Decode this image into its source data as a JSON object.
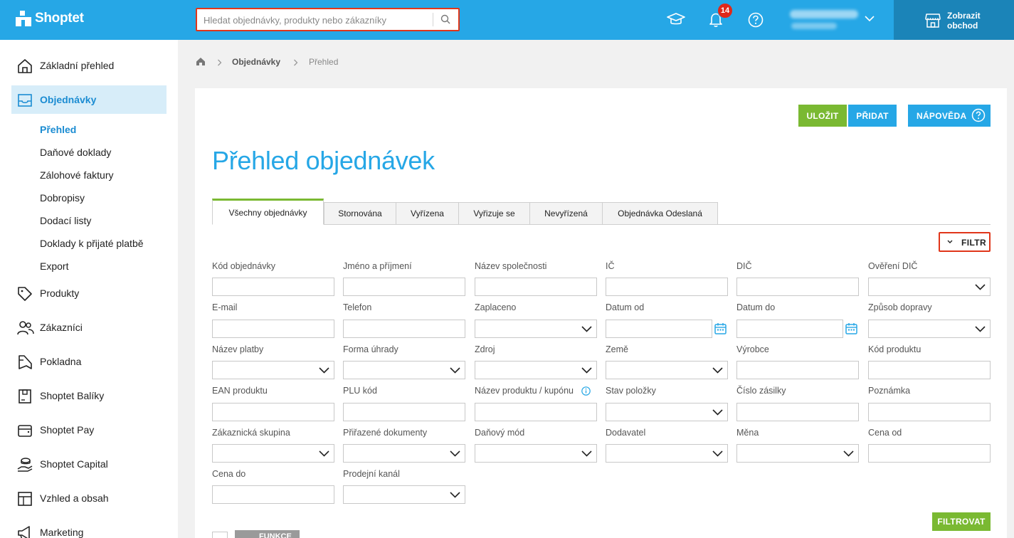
{
  "header": {
    "logo_text": "Shoptet",
    "search_placeholder": "Hledat objednávky, produkty nebo zákazníky",
    "notification_count": "14",
    "store_button": "Zobrazit obchod",
    "colors": {
      "bar": "#26a7e6",
      "store_button": "#1b84b8",
      "badge": "#e0281a"
    }
  },
  "sidebar": {
    "items": [
      {
        "label": "Základní přehled",
        "icon": "home-icon"
      },
      {
        "label": "Objednávky",
        "icon": "inbox-icon",
        "active": true
      },
      {
        "label": "Produkty",
        "icon": "tag-icon"
      },
      {
        "label": "Zákazníci",
        "icon": "users-icon"
      },
      {
        "label": "Pokladna",
        "icon": "receipt-icon"
      },
      {
        "label": "Shoptet Balíky",
        "icon": "package-icon"
      },
      {
        "label": "Shoptet Pay",
        "icon": "wallet-icon"
      },
      {
        "label": "Shoptet Capital",
        "icon": "money-hand-icon"
      },
      {
        "label": "Vzhled a obsah",
        "icon": "layout-icon"
      },
      {
        "label": "Marketing",
        "icon": "megaphone-icon"
      }
    ],
    "subitems": [
      {
        "label": "Přehled",
        "active": true
      },
      {
        "label": "Daňové doklady"
      },
      {
        "label": "Zálohové faktury"
      },
      {
        "label": "Dobropisy"
      },
      {
        "label": "Dodací listy"
      },
      {
        "label": "Doklady k přijaté platbě"
      },
      {
        "label": "Export"
      }
    ]
  },
  "breadcrumb": {
    "section": "Objednávky",
    "current": "Přehled"
  },
  "toolbar": {
    "save": "ULOŽIT",
    "add": "PŘIDAT",
    "help": "NÁPOVĚDA"
  },
  "page_title": "Přehled objednávek",
  "tabs": [
    {
      "label": "Všechny objednávky",
      "active": true
    },
    {
      "label": "Stornována"
    },
    {
      "label": "Vyřízena"
    },
    {
      "label": "Vyřizuje se"
    },
    {
      "label": "Nevyřízená"
    },
    {
      "label": "Objednávka Odeslaná"
    }
  ],
  "filter_button": "FILTR",
  "filters": [
    {
      "label": "Kód objednávky",
      "type": "text"
    },
    {
      "label": "Jméno a příjmení",
      "type": "text"
    },
    {
      "label": "Název společnosti",
      "type": "text"
    },
    {
      "label": "IČ",
      "type": "text"
    },
    {
      "label": "DIČ",
      "type": "text"
    },
    {
      "label": "Ověření DIČ",
      "type": "select"
    },
    {
      "label": "E-mail",
      "type": "text"
    },
    {
      "label": "Telefon",
      "type": "text"
    },
    {
      "label": "Zaplaceno",
      "type": "select"
    },
    {
      "label": "Datum od",
      "type": "date"
    },
    {
      "label": "Datum do",
      "type": "date"
    },
    {
      "label": "Způsob dopravy",
      "type": "select"
    },
    {
      "label": "Název platby",
      "type": "select"
    },
    {
      "label": "Forma úhrady",
      "type": "select"
    },
    {
      "label": "Zdroj",
      "type": "select"
    },
    {
      "label": "Země",
      "type": "select"
    },
    {
      "label": "Výrobce",
      "type": "text"
    },
    {
      "label": "Kód produktu",
      "type": "text"
    },
    {
      "label": "EAN produktu",
      "type": "text"
    },
    {
      "label": "PLU kód",
      "type": "text"
    },
    {
      "label": "Název produktu / kupónu",
      "type": "text",
      "info": true
    },
    {
      "label": "Stav položky",
      "type": "select"
    },
    {
      "label": "Číslo zásilky",
      "type": "text"
    },
    {
      "label": "Poznámka",
      "type": "text"
    },
    {
      "label": "Zákaznická skupina",
      "type": "select"
    },
    {
      "label": "Přiřazené dokumenty",
      "type": "select"
    },
    {
      "label": "Daňový mód",
      "type": "select"
    },
    {
      "label": "Dodavatel",
      "type": "select"
    },
    {
      "label": "Měna",
      "type": "select"
    },
    {
      "label": "Cena od",
      "type": "text"
    },
    {
      "label": "Cena do",
      "type": "text"
    },
    {
      "label": "Prodejní kanál",
      "type": "select"
    }
  ],
  "filter_submit": "FILTROVAT",
  "bulk_action": "FUNKCE"
}
